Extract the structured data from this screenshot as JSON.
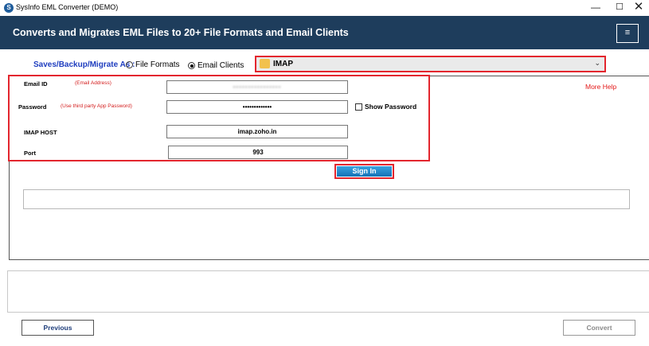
{
  "window": {
    "title": "SysInfo EML Converter (DEMO)",
    "min_glyph": "—",
    "max_glyph": "☐",
    "close_glyph": "✕"
  },
  "header": {
    "title": "Converts and Migrates EML Files to 20+ File Formats and Email Clients",
    "menu_glyph": "≡"
  },
  "save_options": {
    "label": "Saves/Backup/Migrate As :",
    "file_formats": "File Formats",
    "email_clients": "Email Clients",
    "selected": "Email Clients"
  },
  "client_select": {
    "value": "IMAP",
    "chevron": "⌄"
  },
  "credentials": {
    "email": {
      "label": "Email ID",
      "hint": "(Email Address)",
      "value": "••••••••••••••••"
    },
    "password": {
      "label": "Password",
      "hint": "(Use third party App Password)",
      "value": "•••••••••••••"
    },
    "host": {
      "label": "IMAP HOST",
      "value": "imap.zoho.in"
    },
    "port": {
      "label": "Port",
      "value": "993"
    },
    "show_password": "Show Password"
  },
  "more_help": "More Help",
  "sign_in": "Sign In",
  "footer": {
    "previous": "Previous",
    "convert": "Convert"
  },
  "colors": {
    "header_bg": "#1e3d5c",
    "highlight_border": "#e3262e",
    "save_label": "#1e3dbf"
  }
}
